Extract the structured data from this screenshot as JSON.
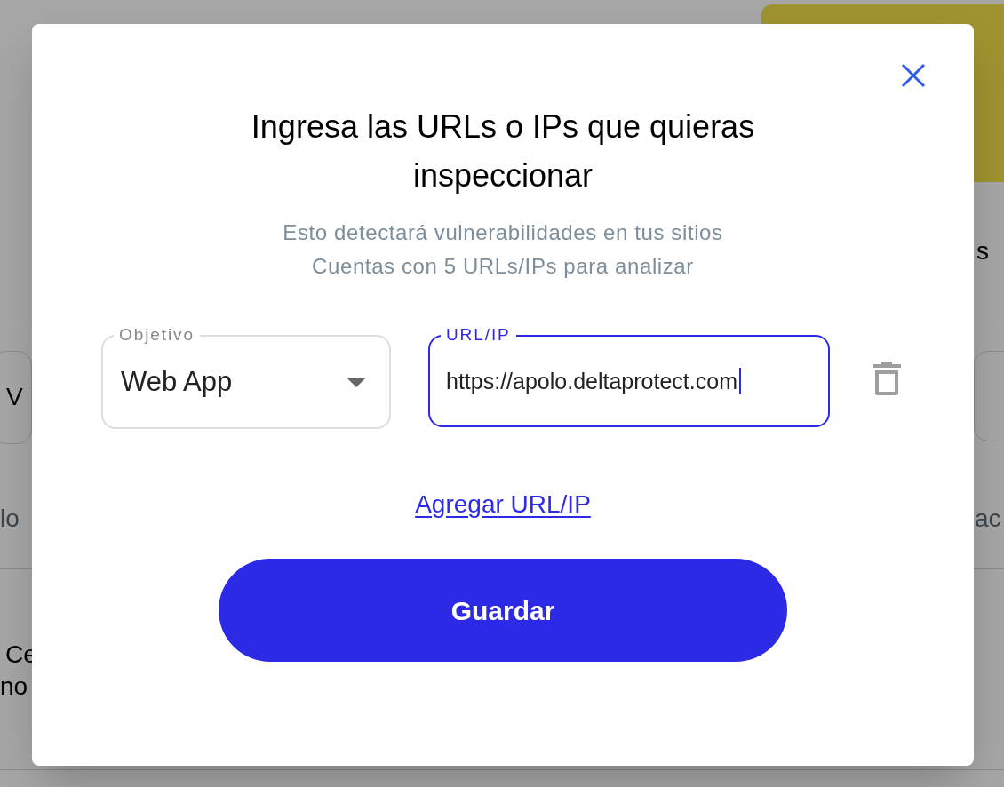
{
  "background": {
    "fragments": [
      {
        "text": "s"
      },
      {
        "text": "V"
      },
      {
        "text": "lo"
      },
      {
        "text": "ac"
      },
      {
        "text": "Ce"
      },
      {
        "text": "no"
      }
    ]
  },
  "modal": {
    "title": "Ingresa las URLs o IPs que quieras inspeccionar",
    "subtitle": [
      "Esto detectará vulnerabilidades en tus sitios",
      "Cuentas con 5 URLs/IPs para analizar"
    ],
    "fields": [
      {
        "kind": "select",
        "label": "Objetivo",
        "value": "Web App",
        "focused": false
      },
      {
        "kind": "text",
        "label": "URL/IP",
        "value": "https://apolo.deltaprotect.com",
        "focused": true
      }
    ],
    "add_link": "Agregar URL/IP",
    "save_button": "Guardar"
  }
}
